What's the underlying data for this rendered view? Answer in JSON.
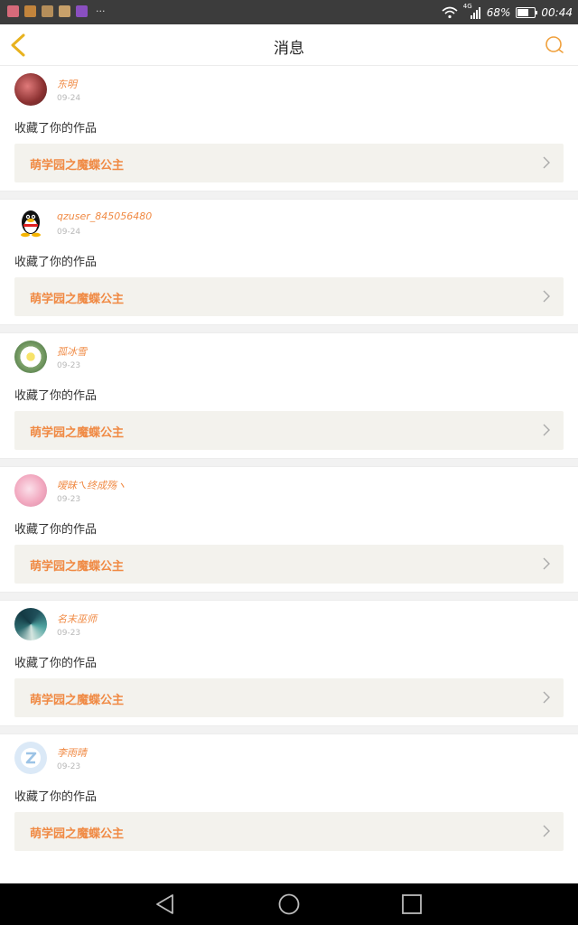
{
  "status_bar": {
    "network": "4G",
    "battery": "68%",
    "time": "00:44",
    "notification_dots": "···"
  },
  "header": {
    "title": "消息"
  },
  "messages": [
    {
      "username": "东明",
      "date": "09-24",
      "action": "收藏了你的作品",
      "work_title": "萌学园之魔蝶公主"
    },
    {
      "username": "qzuser_845056480",
      "date": "09-24",
      "action": "收藏了你的作品",
      "work_title": "萌学园之魔蝶公主"
    },
    {
      "username": "孤冰雪",
      "date": "09-23",
      "action": "收藏了你的作品",
      "work_title": "萌学园之魔蝶公主"
    },
    {
      "username": "嗳昧ㄟ终成殇ヽ",
      "date": "09-23",
      "action": "收藏了你的作品",
      "work_title": "萌学园之魔蝶公主"
    },
    {
      "username": "名末巫师",
      "date": "09-23",
      "action": "收藏了你的作品",
      "work_title": "萌学园之魔蝶公主"
    },
    {
      "username": "李雨晴",
      "date": "09-23",
      "action": "收藏了你的作品",
      "work_title": "萌学园之魔蝶公主"
    }
  ],
  "colors": {
    "accent": "#f08a44",
    "back_arrow": "#e8b21e",
    "card_bg": "#f3f2ed"
  }
}
